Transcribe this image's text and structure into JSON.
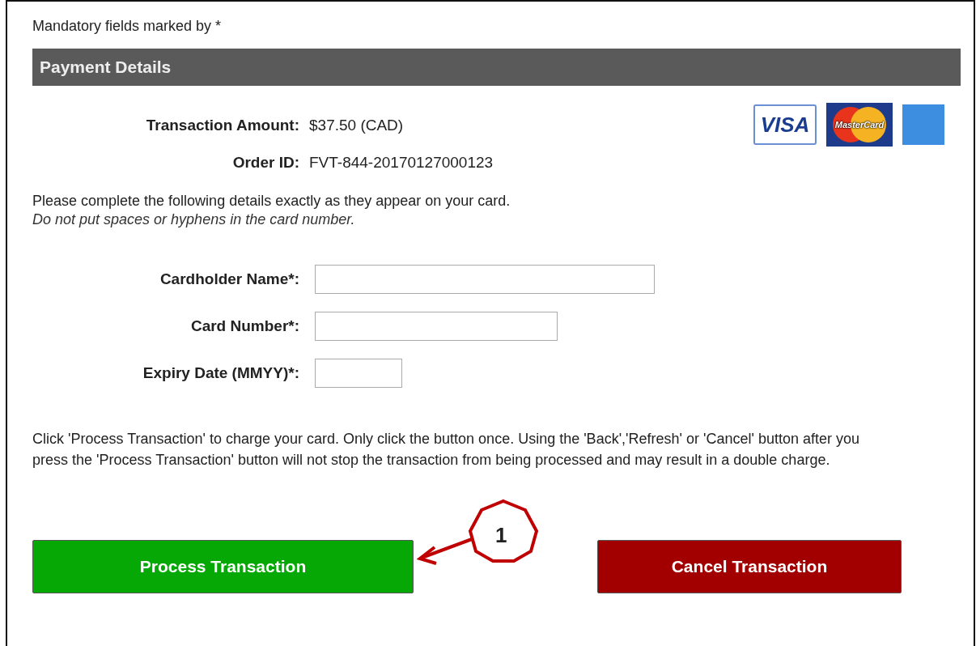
{
  "mandatory_note": "Mandatory fields marked by *",
  "section_title": "Payment Details",
  "summary": [
    {
      "label": "Transaction Amount:",
      "value": "$37.50 (CAD)"
    },
    {
      "label": "Order ID:",
      "value": "FVT-844-20170127000123"
    }
  ],
  "card_logos": [
    {
      "kind": "visa",
      "label": "VISA"
    },
    {
      "kind": "mastercard",
      "label": "MasterCard"
    },
    {
      "kind": "amex"
    }
  ],
  "instructions": "Please complete the following details exactly as they appear on your card.",
  "instructions_note": "Do not put spaces or hyphens in the card number.",
  "fields": [
    {
      "label": "Cardholder Name*:",
      "kind": "name"
    },
    {
      "label": "Card Number*:",
      "kind": "number"
    },
    {
      "label": "Expiry Date (MMYY)*:",
      "kind": "expiry"
    }
  ],
  "warning": "Click 'Process Transaction' to charge your card. Only click the button once. Using the 'Back','Refresh' or 'Cancel' button after you press the 'Process Transaction' button will not stop the transaction from being processed and may result in a double charge.",
  "buttons": [
    {
      "kind": "process",
      "label": "Process Transaction"
    },
    {
      "kind": "cancel",
      "label": "Cancel Transaction"
    }
  ],
  "callout": {
    "label": "1"
  }
}
